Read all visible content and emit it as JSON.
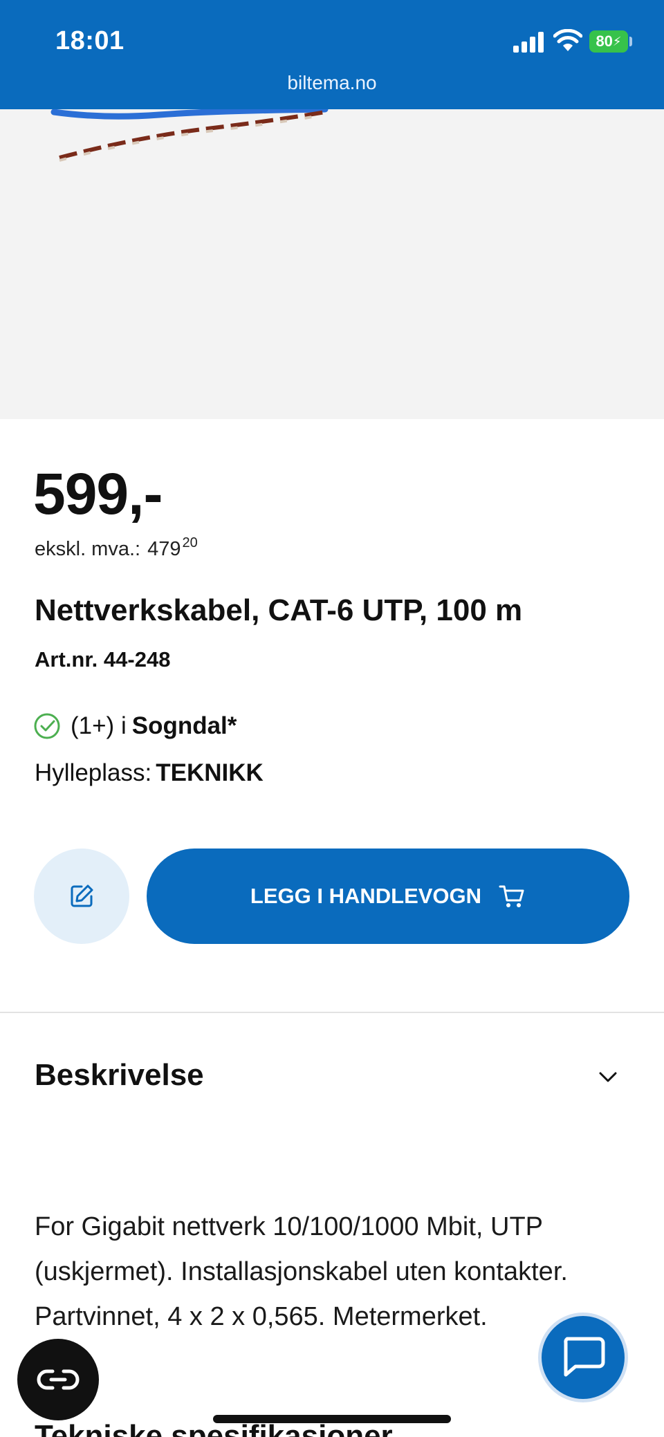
{
  "status": {
    "time": "18:01",
    "battery": "80",
    "url": "biltema.no"
  },
  "colors": {
    "brand_blue": "#0a6bbd",
    "light_blue": "#e3eff9",
    "success_green": "#4caf50"
  },
  "product": {
    "price": "599,-",
    "price_excl_label": "ekskl. mva.:",
    "price_excl_value": "479",
    "price_excl_cents": "20",
    "title": "Nettverkskabel, CAT-6 UTP, 100 m",
    "article_number": "Art.nr. 44-248",
    "stock_count": "(1+) i",
    "stock_store": "Sogndal*",
    "shelf_label": "Hylleplass:",
    "shelf_value": "TEKNIKK"
  },
  "actions": {
    "add_to_cart_label": "LEGG I HANDLEVOGN",
    "note_icon": "edit-icon",
    "cart_icon": "cart-icon"
  },
  "sections": {
    "description_title": "Beskrivelse",
    "description_text": "For Gigabit nettverk 10/100/1000 Mbit, UTP (uskjermet). Installasjonskabel uten kontakter. Partvinnet, 4 x 2 x 0,565. Metermerket.",
    "next_title": "Tekniske spesifikasjoner"
  }
}
